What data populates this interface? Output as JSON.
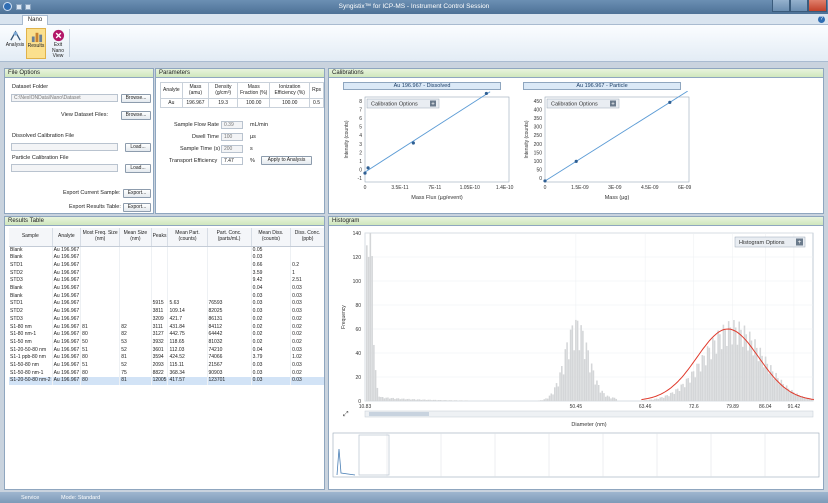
{
  "window": {
    "title": "Syngistix™ for ICP-MS - Instrument Control Session"
  },
  "tabs": [
    "Nano"
  ],
  "ribbon": {
    "buttons": [
      {
        "label": "Analysis"
      },
      {
        "label": "Results"
      },
      {
        "label": "Exit Nano View"
      }
    ]
  },
  "file_options": {
    "header": "File Options",
    "dataset_folder_label": "Dataset Folder",
    "dataset_folder_value": "C:\\NexIONData\\Nano\\Dataset",
    "browse1": "Browse...",
    "view_dataset_files": "View Dataset Files:",
    "browse2": "Browse...",
    "dissolved_cal_label": "Dissolved Calibration File",
    "load1": "Load...",
    "particle_cal_label": "Particle Calibration File",
    "load2": "Load...",
    "export_current_label": "Export Current Sample:",
    "export1": "Export...",
    "export_results_label": "Export Results Table:",
    "export2": "Export..."
  },
  "parameters": {
    "header": "Parameters",
    "columns": [
      "Analyte",
      "Mass (amu)",
      "Density (g/cm³)",
      "Mass Fraction (%)",
      "Ionization Efficiency (%)",
      "Rps"
    ],
    "row": [
      "Au",
      "196.967",
      "19.3",
      "100.00",
      "100.00",
      "0.5"
    ],
    "fields": [
      {
        "label": "Sample Flow Rate",
        "value": "0.39",
        "unit": "mL/min"
      },
      {
        "label": "Dwell Time",
        "value": "100",
        "unit": "µs"
      },
      {
        "label": "Sample Time (s)",
        "value": "200",
        "unit": "s"
      },
      {
        "label": "Transport Efficiency",
        "value": "7.47",
        "unit": "%"
      }
    ],
    "apply_button": "Apply to Analysis"
  },
  "calibrations": {
    "header": "Calibrations",
    "dissolved": {
      "title": "Au 196.967 - Dissolved",
      "options_button": "Calibration Options",
      "xlabel": "Mass Flux (µg/event)",
      "ylabel": "Intensity (counts)",
      "xticks": [
        "0",
        "3.5E-11",
        "7E-11",
        "1.05E-10",
        "1.4E-10"
      ],
      "yticks": [
        "8",
        "7",
        "6",
        "5",
        "4",
        "3",
        "2",
        "1",
        "0",
        "-1"
      ]
    },
    "particle": {
      "title": "Au 196.967 - Particle",
      "options_button": "Calibration Options",
      "xlabel": "Mass (µg)",
      "ylabel": "Intensity (counts)",
      "xticks": [
        "0",
        "1.5E-09",
        "3E-09",
        "4.5E-09",
        "6E-09"
      ],
      "yticks": [
        "450",
        "400",
        "350",
        "300",
        "250",
        "200",
        "150",
        "100",
        "50",
        "0"
      ]
    }
  },
  "results": {
    "header": "Results Table",
    "columns": [
      "Sample",
      "Analyte",
      "Most Freq. Size (nm)",
      "Mean Size (nm)",
      "Peaks",
      "Mean Part. (counts)",
      "Part. Conc. (parts/mL)",
      "Mean Diss. (counts)",
      "Diss. Conc. (ppb)"
    ],
    "rows": [
      [
        "Blank",
        "Au 196.967",
        "",
        "",
        "",
        "",
        "",
        "0.05",
        ""
      ],
      [
        "Blank",
        "Au 196.967",
        "",
        "",
        "",
        "",
        "",
        "0.03",
        ""
      ],
      [
        "STD1",
        "Au 196.967",
        "",
        "",
        "",
        "",
        "",
        "0.66",
        "0.2"
      ],
      [
        "STD2",
        "Au 196.967",
        "",
        "",
        "",
        "",
        "",
        "3.59",
        "1"
      ],
      [
        "STD3",
        "Au 196.967",
        "",
        "",
        "",
        "",
        "",
        "9.42",
        "2.51"
      ],
      [
        "Blank",
        "Au 196.967",
        "",
        "",
        "",
        "",
        "",
        "0.04",
        "0.03"
      ],
      [
        "Blank",
        "Au 196.967",
        "",
        "",
        "",
        "",
        "",
        "0.03",
        "0.03"
      ],
      [
        "STD1",
        "Au 196.967",
        "",
        "",
        "5915",
        "5.63",
        "76593",
        "0.03",
        "0.03"
      ],
      [
        "STD2",
        "Au 196.967",
        "",
        "",
        "3811",
        "109.14",
        "82025",
        "0.03",
        "0.03"
      ],
      [
        "STD3",
        "Au 196.967",
        "",
        "",
        "3209",
        "421.7",
        "86131",
        "0.02",
        "0.02"
      ],
      [
        "S1-80 nm",
        "Au 196.967",
        "81",
        "82",
        "3111",
        "431.84",
        "84112",
        "0.02",
        "0.02"
      ],
      [
        "S1-80 nm-1",
        "Au 196.967",
        "80",
        "82",
        "3127",
        "442.75",
        "64442",
        "0.02",
        "0.02"
      ],
      [
        "S1-50 nm",
        "Au 196.967",
        "50",
        "53",
        "3932",
        "118.65",
        "81032",
        "0.02",
        "0.02"
      ],
      [
        "S1-20-50-80 nm",
        "Au 196.967",
        "51",
        "52",
        "3601",
        "112.03",
        "74210",
        "0.04",
        "0.03"
      ],
      [
        "S1-1 ppb-80 nm",
        "Au 196.967",
        "80",
        "81",
        "3594",
        "424.52",
        "74066",
        "3.79",
        "1.02"
      ],
      [
        "S1-50-80 nm",
        "Au 196.967",
        "51",
        "52",
        "2093",
        "115.11",
        "21567",
        "0.03",
        "0.03"
      ],
      [
        "S1-50-80 nm-1",
        "Au 196.967",
        "80",
        "75",
        "8822",
        "368.34",
        "90903",
        "0.03",
        "0.02"
      ],
      [
        "S1-20-50-80 nm-2",
        "Au 196.967",
        "80",
        "81",
        "12005",
        "417.57",
        "123701",
        "0.03",
        "0.03"
      ]
    ]
  },
  "histogram": {
    "header": "Histogram",
    "options_button": "Histogram Options",
    "xlabel": "Diameter (nm)",
    "ylabel": "Frequency"
  },
  "chart_data": [
    {
      "type": "scatter",
      "title": "Au 196.967 - Dissolved",
      "xlabel": "Mass Flux (µg/event)",
      "ylabel": "Intensity (counts)",
      "xlim": [
        0,
        1.4e-10
      ],
      "ylim": [
        -1,
        9
      ],
      "x": [
        0,
        3e-12,
        4.7e-11,
        1.18e-10
      ],
      "y": [
        0.05,
        0.66,
        3.59,
        9.42
      ],
      "fit": true
    },
    {
      "type": "scatter",
      "title": "Au 196.967 - Particle",
      "xlabel": "Mass (µg)",
      "ylabel": "Intensity (counts)",
      "xlim": [
        0,
        6e-09
      ],
      "ylim": [
        0,
        450
      ],
      "x": [
        0,
        1.3e-09,
        5.2e-09
      ],
      "y": [
        5.63,
        109.14,
        421.7
      ],
      "fit": true
    },
    {
      "type": "bar",
      "title": "",
      "xlabel": "Diameter (nm)",
      "ylabel": "Frequency",
      "xlim": [
        10.83,
        95
      ],
      "ylim": [
        0,
        140
      ],
      "xticks": [
        "10.83",
        "50.45",
        "63.46",
        "72.6",
        "79.89",
        "86.04",
        "91.42"
      ],
      "yticks": [
        "140",
        "120",
        "100",
        "80",
        "60",
        "40",
        "20",
        "0"
      ],
      "peaks": [
        {
          "center": 11.5,
          "height": 138,
          "width": 0.6
        },
        {
          "center": 50.45,
          "height": 55,
          "width": 2.2
        },
        {
          "center": 79.89,
          "height": 55,
          "width": 5.5
        }
      ],
      "fit_curve": {
        "center": 79.0,
        "height": 60,
        "width": 5.8
      }
    }
  ],
  "status": {
    "left": "Service",
    "mode": "Mode: Standard"
  }
}
